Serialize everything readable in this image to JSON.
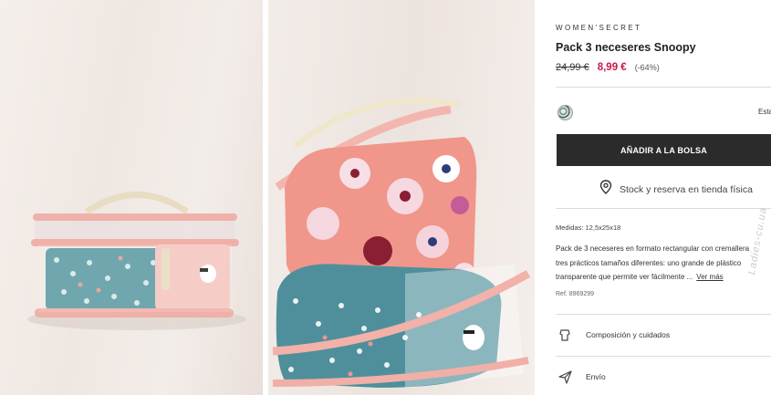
{
  "product": {
    "brand": "WOMEN'SECRET",
    "title": "Pack 3 neceseres Snoopy",
    "old_price": "24,99 €",
    "new_price": "8,99 €",
    "discount": "(-64%)",
    "swatch_label": "Esta",
    "add_to_bag": "AÑADIR A LA BOLSA",
    "stock_link": "Stock y reserva en tienda física",
    "measures": "Medidas: 12,5x25x18",
    "description_lines": [
      "Pack de 3 neceseres en formato rectangular con cremallera",
      "tres prácticos tamaños diferentes: uno grande de plástico",
      "transparente que permite ver fácilmente ..."
    ],
    "more_link": "Ver más",
    "reference": "Ref. 8969299",
    "composition": "Composición y cuidados",
    "shipping": "Envío"
  },
  "icons": {
    "stock": "location-pin-icon",
    "composition": "leaf-care-icon",
    "shipping": "send-arrow-icon"
  },
  "colors": {
    "accent_price": "#c8174a",
    "button_bg": "#2b2b2b",
    "bag_pink": "#f1a79f",
    "floral_teal": "#5d9ba4"
  },
  "watermark": "Ladies-cu.ua"
}
